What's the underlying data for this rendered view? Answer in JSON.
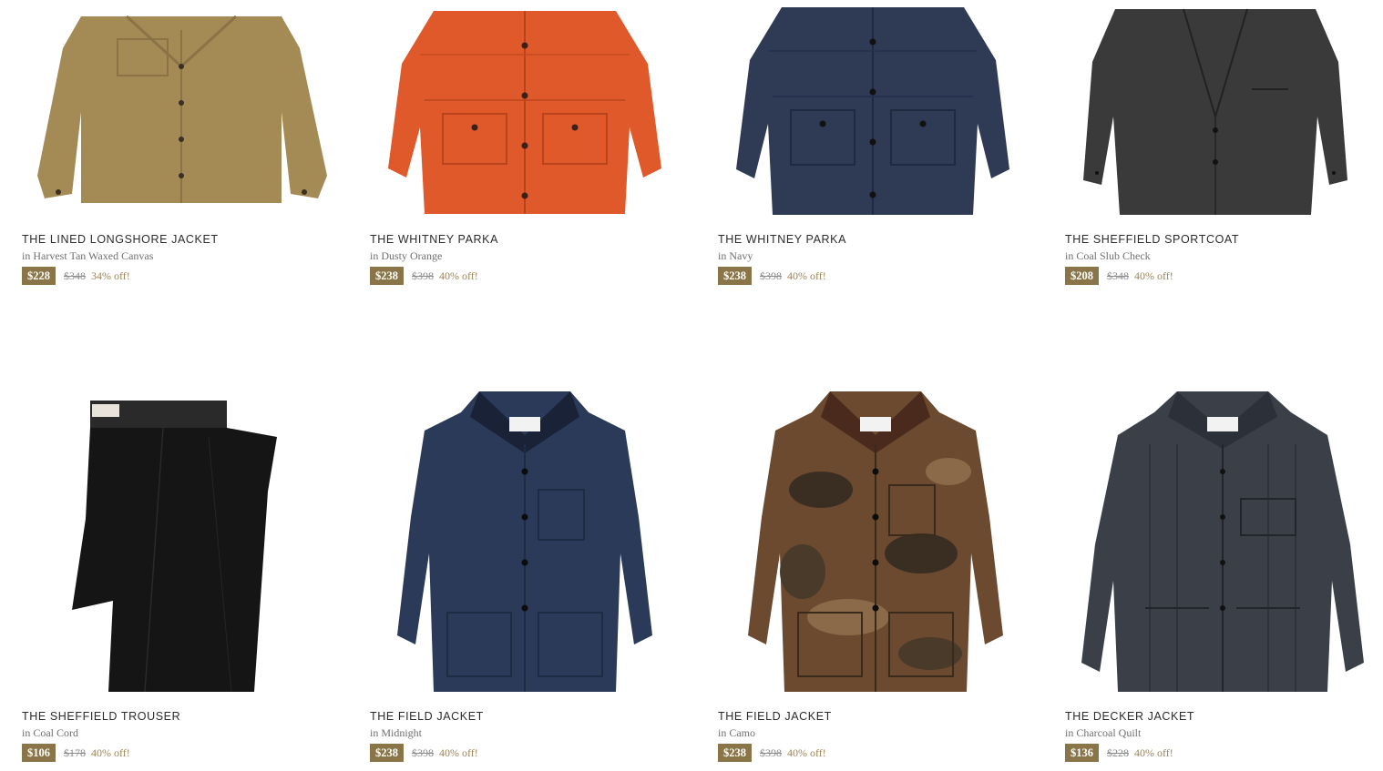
{
  "products": [
    {
      "title": "THE LINED LONGSHORE JACKET",
      "in": "in",
      "variant": "Harvest Tan Waxed Canvas",
      "sale": "$228",
      "original": "$348",
      "discount": "34% off!",
      "image": "tan-canvas-jacket"
    },
    {
      "title": "THE WHITNEY PARKA",
      "in": "in",
      "variant": "Dusty Orange",
      "sale": "$238",
      "original": "$398",
      "discount": "40% off!",
      "image": "orange-parka"
    },
    {
      "title": "THE WHITNEY PARKA",
      "in": "in",
      "variant": "Navy",
      "sale": "$238",
      "original": "$398",
      "discount": "40% off!",
      "image": "navy-parka"
    },
    {
      "title": "THE SHEFFIELD SPORTCOAT",
      "in": "in",
      "variant": "Coal Slub Check",
      "sale": "$208",
      "original": "$348",
      "discount": "40% off!",
      "image": "charcoal-sportcoat"
    },
    {
      "title": "THE SHEFFIELD TROUSER",
      "in": "in",
      "variant": "Coal Cord",
      "sale": "$106",
      "original": "$178",
      "discount": "40% off!",
      "image": "black-cord-trouser"
    },
    {
      "title": "THE FIELD JACKET",
      "in": "in",
      "variant": "Midnight",
      "sale": "$238",
      "original": "$398",
      "discount": "40% off!",
      "image": "midnight-field-jacket"
    },
    {
      "title": "THE FIELD JACKET",
      "in": "in",
      "variant": "Camo",
      "sale": "$238",
      "original": "$398",
      "discount": "40% off!",
      "image": "camo-field-jacket"
    },
    {
      "title": "THE DECKER JACKET",
      "in": "in",
      "variant": "Charcoal Quilt",
      "sale": "$136",
      "original": "$228",
      "discount": "40% off!",
      "image": "charcoal-quilted-jacket"
    }
  ],
  "colors": {
    "sale_badge": "#8a7548",
    "discount_text": "#9c8458",
    "tan": "#a48a55",
    "orange": "#e0592a",
    "navy": "#2f3b55",
    "charcoal": "#3a3a3a",
    "black": "#151515",
    "midnight": "#2a3a58",
    "camo": "#6b4a30",
    "quilt": "#3a3f48"
  }
}
